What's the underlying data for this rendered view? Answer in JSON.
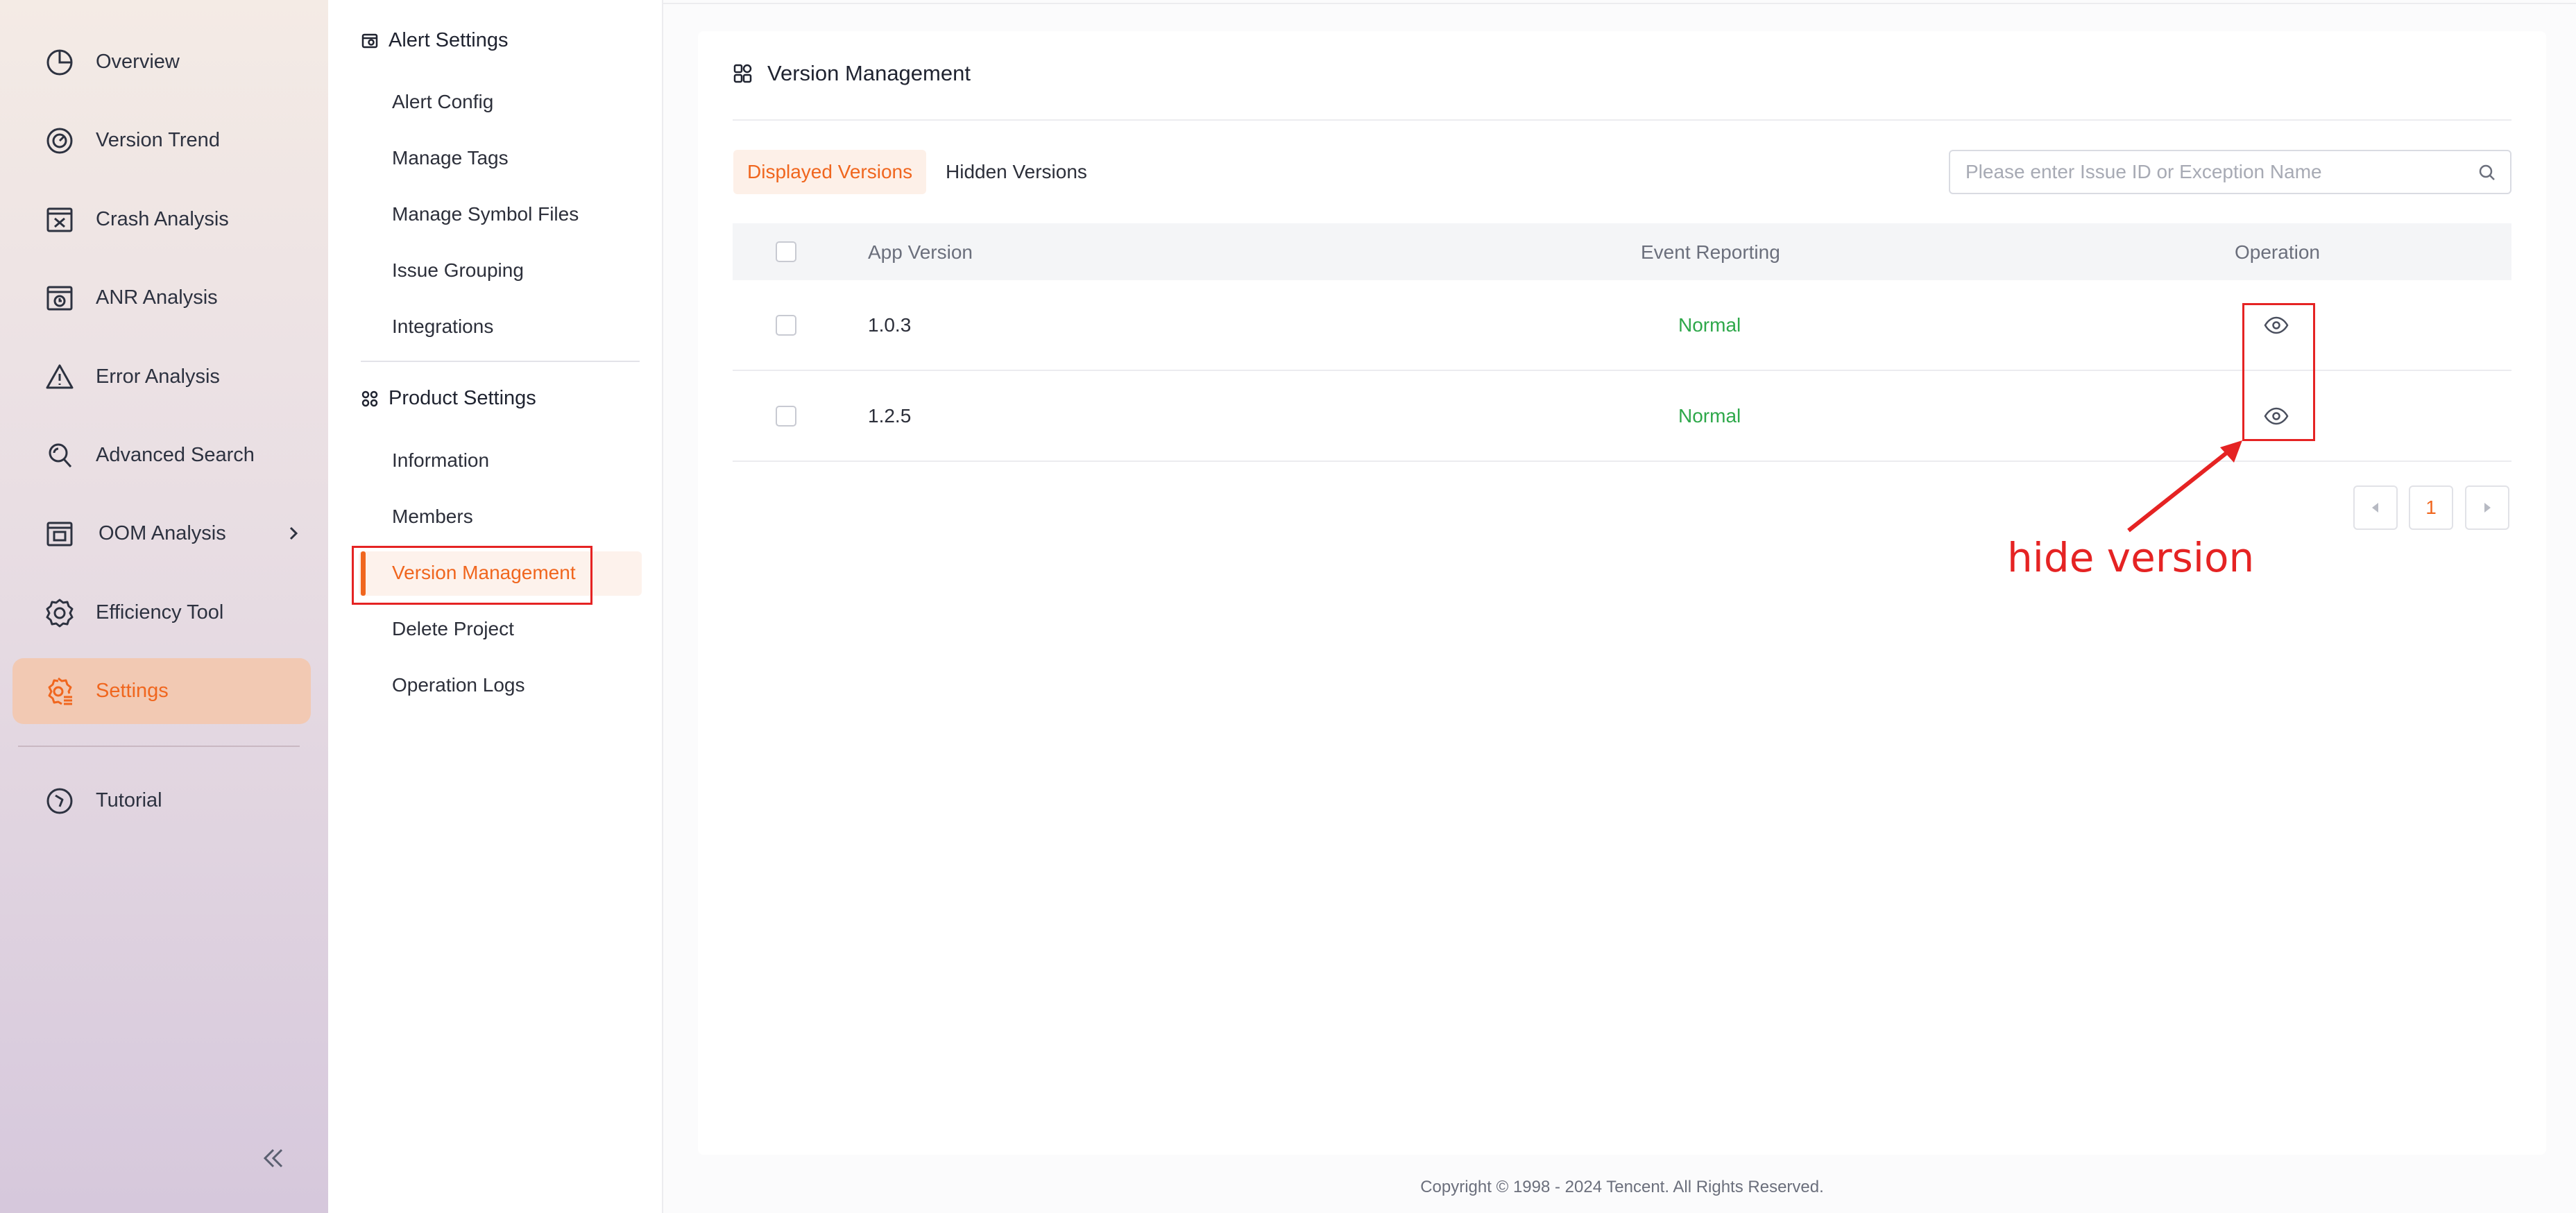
{
  "colors": {
    "accent": "#f0661e",
    "status_normal": "#2ea84a",
    "annotation": "#e52323",
    "nav_active_bg": "#f2c9b3"
  },
  "nav": {
    "items": [
      {
        "label": "Overview",
        "icon": "pie-chart-icon"
      },
      {
        "label": "Version Trend",
        "icon": "gauge-icon"
      },
      {
        "label": "Crash Analysis",
        "icon": "crash-window-icon"
      },
      {
        "label": "ANR Analysis",
        "icon": "anr-window-icon"
      },
      {
        "label": "Error Analysis",
        "icon": "warning-triangle-icon"
      },
      {
        "label": "Advanced Search",
        "icon": "search-magnifier-icon"
      },
      {
        "label": "OOM Analysis",
        "icon": "memory-window-icon"
      },
      {
        "label": "Efficiency Tool",
        "icon": "gear-icon"
      },
      {
        "label": "Settings",
        "icon": "settings-gear-icon"
      },
      {
        "label": "Tutorial",
        "icon": "compass-icon"
      }
    ],
    "active": "Settings"
  },
  "submenu": {
    "alert_title": "Alert Settings",
    "alert_items": [
      "Alert Config",
      "Manage Tags",
      "Manage Symbol Files",
      "Issue Grouping",
      "Integrations"
    ],
    "product_title": "Product Settings",
    "product_items": [
      "Information",
      "Members",
      "Version Management",
      "Delete Project",
      "Operation Logs"
    ],
    "active": "Version Management"
  },
  "main": {
    "title": "Version Management",
    "tabs": [
      {
        "label": "Displayed Versions",
        "active": true
      },
      {
        "label": "Hidden Versions",
        "active": false
      }
    ],
    "search": {
      "placeholder": "Please enter Issue ID or Exception Name",
      "value": ""
    },
    "table": {
      "headers": [
        "App Version",
        "Event Reporting",
        "Operation"
      ],
      "rows": [
        {
          "version": "1.0.3",
          "status": "Normal",
          "operation": "eye-icon"
        },
        {
          "version": "1.2.5",
          "status": "Normal",
          "operation": "eye-icon"
        }
      ]
    },
    "pagination": {
      "current": "1"
    }
  },
  "annotation": {
    "text": "hide version"
  },
  "footer": "Copyright © 1998 - 2024 Tencent. All Rights Reserved."
}
